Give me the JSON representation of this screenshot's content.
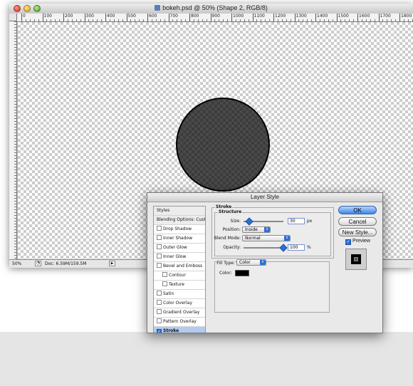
{
  "document": {
    "title": "bokeh.psd @ 50% (Shape 2, RGB/8)",
    "ruler_labels": [
      "0",
      "100",
      "200",
      "300",
      "400",
      "500",
      "600",
      "700",
      "800",
      "900",
      "1000",
      "1100",
      "1200",
      "1300",
      "1400",
      "1500",
      "1600",
      "1700",
      "1800",
      "190"
    ],
    "status_zoom": "50%",
    "status_doc": "Doc: 6.59M/159.5M"
  },
  "dialog": {
    "title": "Layer Style",
    "styles_header": "Styles",
    "blending_options": "Blending Options: Custom",
    "effects": [
      {
        "label": "Drop Shadow",
        "checked": false
      },
      {
        "label": "Inner Shadow",
        "checked": false
      },
      {
        "label": "Outer Glow",
        "checked": false
      },
      {
        "label": "Inner Glow",
        "checked": false
      },
      {
        "label": "Bevel and Emboss",
        "checked": false
      },
      {
        "label": "Contour",
        "checked": false
      },
      {
        "label": "Texture",
        "checked": false
      },
      {
        "label": "Satin",
        "checked": false
      },
      {
        "label": "Color Overlay",
        "checked": false
      },
      {
        "label": "Gradient Overlay",
        "checked": false
      },
      {
        "label": "Pattern Overlay",
        "checked": false
      },
      {
        "label": "Stroke",
        "checked": true
      }
    ],
    "stroke": {
      "group_label": "Stroke",
      "structure_label": "Structure",
      "size_label": "Size:",
      "size_value": "30",
      "size_unit": "px",
      "position_label": "Position:",
      "position_value": "Inside",
      "blend_mode_label": "Blend Mode:",
      "blend_mode_value": "Normal",
      "opacity_label": "Opacity:",
      "opacity_value": "100",
      "opacity_unit": "%",
      "fill_type_label": "Fill Type:",
      "fill_type_value": "Color",
      "color_label": "Color:",
      "color_value": "#000000"
    },
    "buttons": {
      "ok": "OK",
      "cancel": "Cancel",
      "new_style": "New Style...",
      "preview": "Preview"
    }
  }
}
